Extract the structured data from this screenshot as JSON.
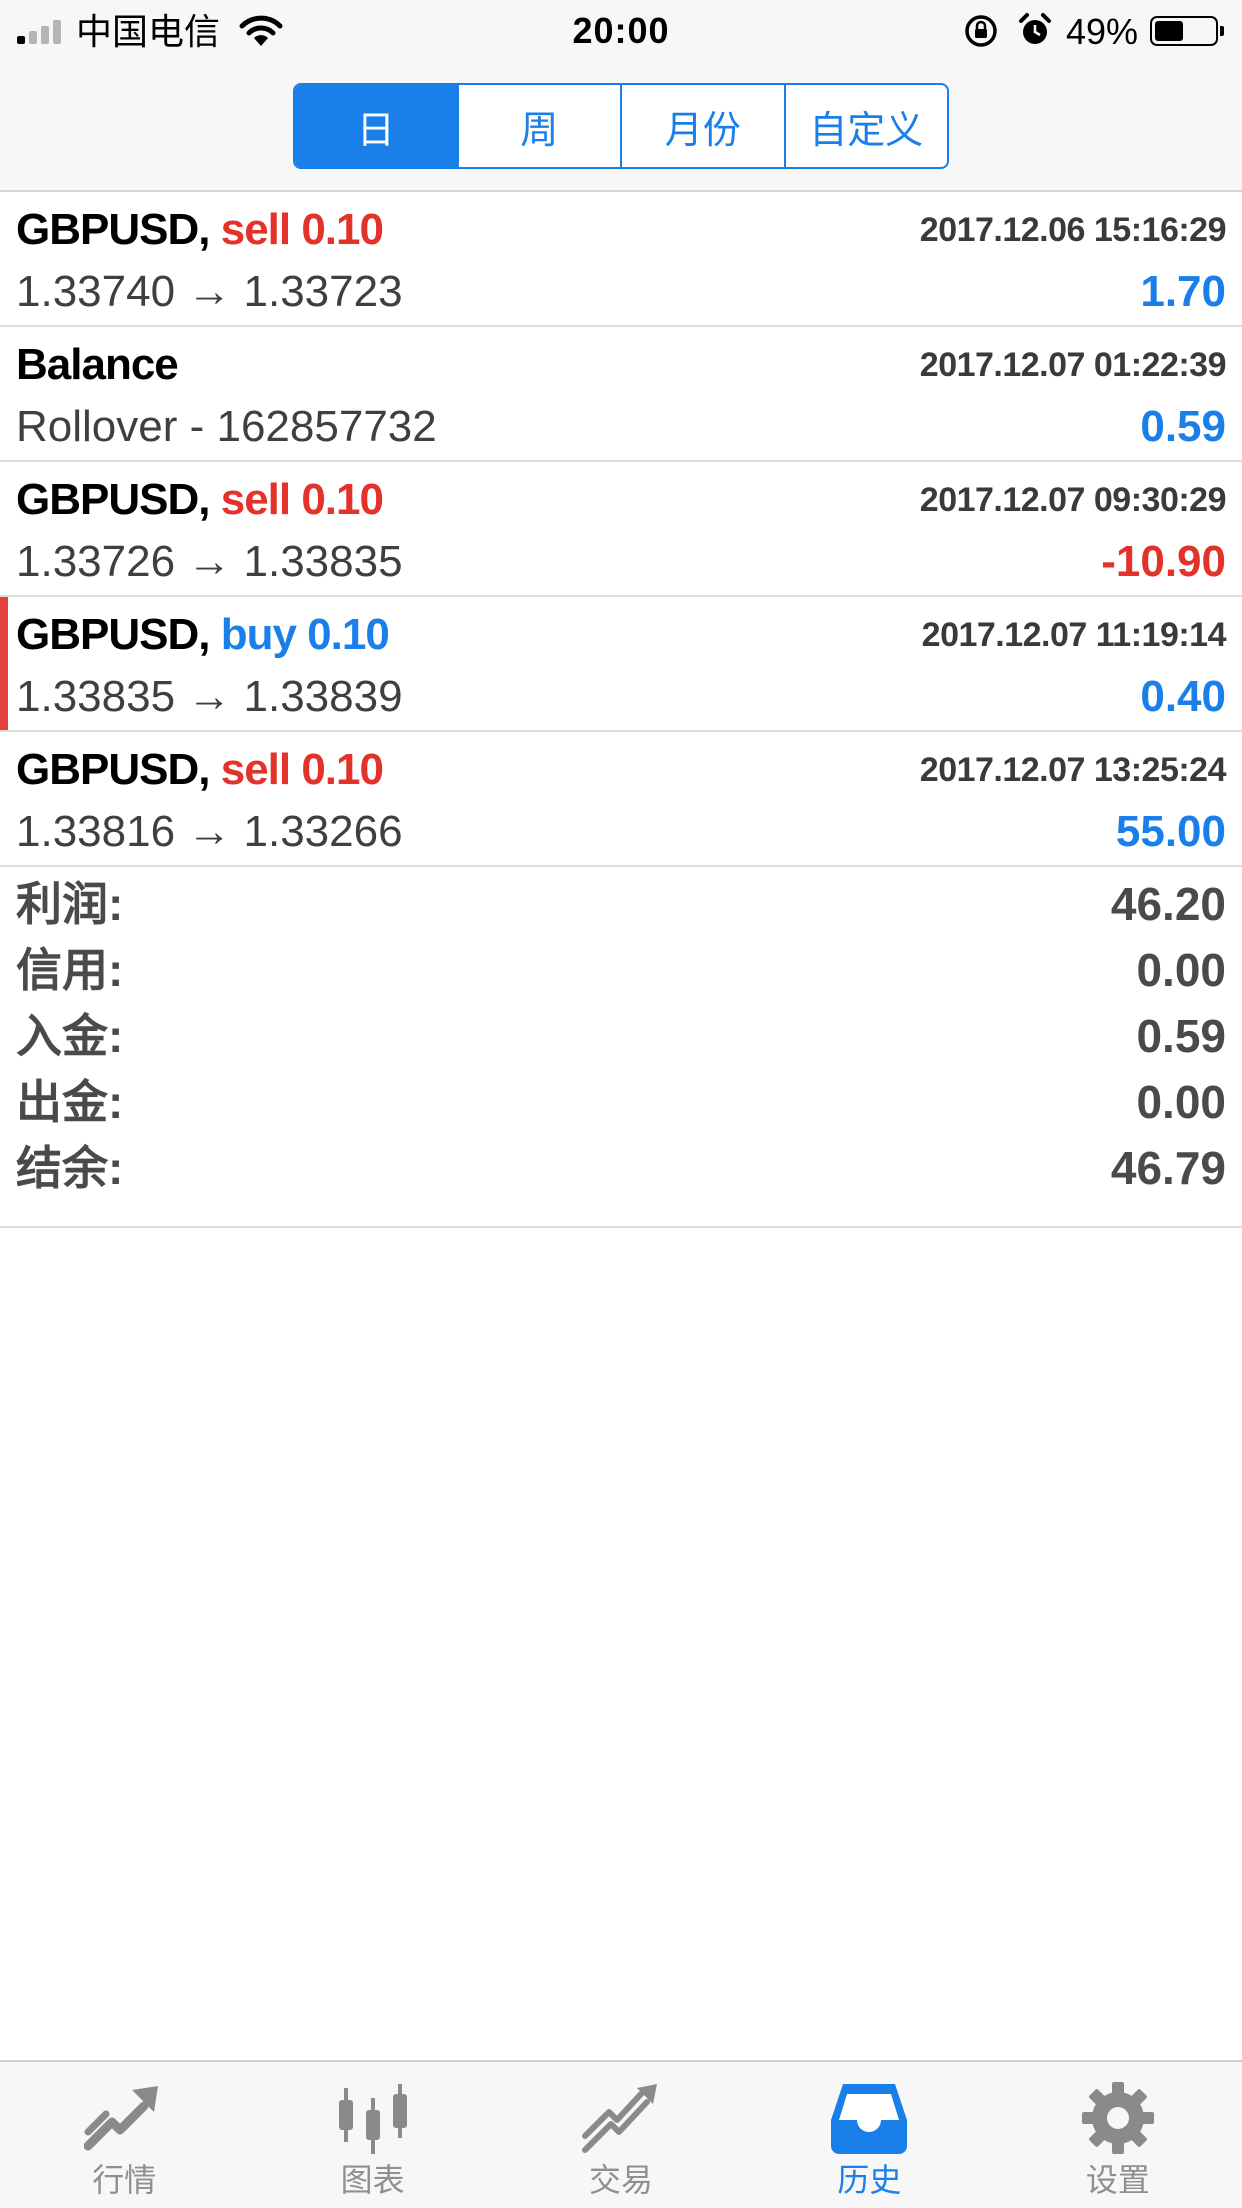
{
  "status_bar": {
    "carrier": "中国电信",
    "time": "20:00",
    "battery": "49%",
    "battery_level": 0.49
  },
  "period_tabs": [
    {
      "label": "日",
      "active": true
    },
    {
      "label": "周",
      "active": false
    },
    {
      "label": "月份",
      "active": false
    },
    {
      "label": "自定义",
      "active": false
    }
  ],
  "deals": [
    {
      "symbol": "GBPUSD,",
      "side": "sell 0.10",
      "datetime": "2017.12.06 15:16:29",
      "prices": "1.33740 → 1.33723",
      "profit": "1.70"
    },
    {
      "symbol": "Balance",
      "side": "",
      "datetime": "2017.12.07 01:22:39",
      "prices": "Rollover - 162857732",
      "profit": "0.59"
    },
    {
      "symbol": "GBPUSD,",
      "side": "sell 0.10",
      "datetime": "2017.12.07 09:30:29",
      "prices": "1.33726 → 1.33835",
      "profit": "-10.90"
    },
    {
      "symbol": "GBPUSD,",
      "side": "buy 0.10",
      "datetime": "2017.12.07 11:19:14",
      "prices": "1.33835 → 1.33839",
      "profit": "0.40"
    },
    {
      "symbol": "GBPUSD,",
      "side": "sell 0.10",
      "datetime": "2017.12.07 13:25:24",
      "prices": "1.33816 → 1.33266",
      "profit": "55.00"
    }
  ],
  "summary": [
    {
      "label": "利润:",
      "value": "46.20"
    },
    {
      "label": "信用:",
      "value": "0.00"
    },
    {
      "label": "入金:",
      "value": "0.59"
    },
    {
      "label": "出金:",
      "value": "0.00"
    },
    {
      "label": "结余:",
      "value": "46.79"
    }
  ],
  "tabbar": [
    {
      "label": "行情",
      "icon": "quotes-arrow-icon",
      "active": false
    },
    {
      "label": "图表",
      "icon": "candlestick-chart-icon",
      "active": false
    },
    {
      "label": "交易",
      "icon": "trade-trend-icon",
      "active": false
    },
    {
      "label": "历史",
      "icon": "history-inbox-icon",
      "active": true
    },
    {
      "label": "设置",
      "icon": "gear-icon",
      "active": false
    }
  ],
  "colors": {
    "accent": "#1a7fe8",
    "negative": "#e3322a",
    "marker": "#e3413a",
    "inactive_icon": "#8a8a8a"
  }
}
